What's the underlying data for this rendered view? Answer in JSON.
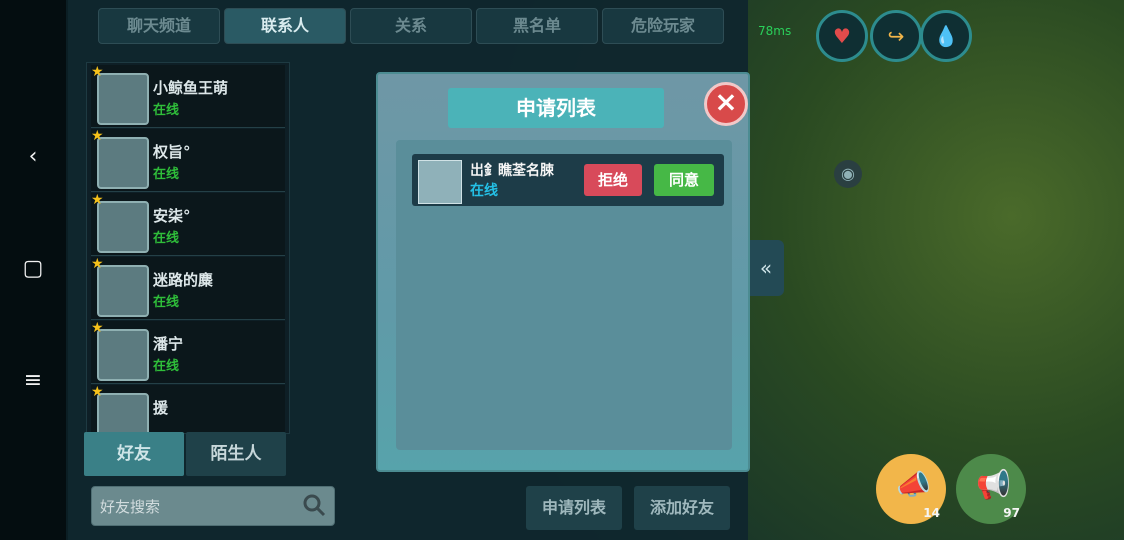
{
  "system_bar": {
    "back_icon": "chevron-left-icon",
    "home_icon": "square-icon",
    "menu_icon": "hamburger-icon"
  },
  "tabs": [
    {
      "label": "聊天频道"
    },
    {
      "label": "联系人"
    },
    {
      "label": "关系"
    },
    {
      "label": "黑名单"
    },
    {
      "label": "危险玩家"
    }
  ],
  "friends": [
    {
      "name": "小鲸鱼王萌",
      "status": "在线"
    },
    {
      "name": "权旨°",
      "status": "在线"
    },
    {
      "name": "安柒°",
      "status": "在线"
    },
    {
      "name": "迷路的麋",
      "status": "在线"
    },
    {
      "name": "潘宁",
      "status": "在线"
    },
    {
      "name": "援",
      "status": ""
    }
  ],
  "bottom_tabs": {
    "friends": "好友",
    "strangers": "陌生人"
  },
  "search": {
    "placeholder": "好友搜索"
  },
  "footer": {
    "request_list": "申请列表",
    "add_friend": "添加好友"
  },
  "modal": {
    "title": "申请列表",
    "request": {
      "name": "岀釒瞧荃名脨",
      "status": "在线",
      "reject": "拒绝",
      "accept": "同意"
    }
  },
  "hud": {
    "ping": "78ms"
  },
  "horns": [
    {
      "count": "14"
    },
    {
      "count": "97"
    }
  ],
  "colors": {
    "online_green": "#2fbe3a",
    "modal_title_teal": "#4bb3b8",
    "reject_red": "#d84a5a",
    "accept_green": "#46b846"
  }
}
